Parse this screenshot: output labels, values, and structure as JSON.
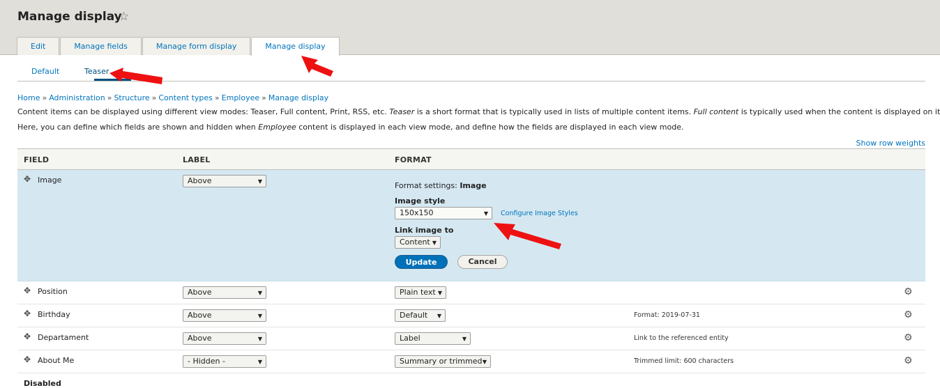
{
  "header": {
    "title": "Manage display",
    "star_glyph": "☆",
    "tabs": [
      {
        "label": "Edit"
      },
      {
        "label": "Manage fields"
      },
      {
        "label": "Manage form display"
      },
      {
        "label": "Manage display",
        "active": true
      }
    ]
  },
  "subtabs": [
    {
      "label": "Default"
    },
    {
      "label": "Teaser",
      "active": true
    }
  ],
  "breadcrumb": [
    "Home",
    "Administration",
    "Structure",
    "Content types",
    "Employee",
    "Manage display"
  ],
  "breadcrumb_sep": "»",
  "description": {
    "line1_a": "Content items can be displayed using different view modes: Teaser, Full content, Print, RSS, etc. ",
    "line1_em1": "Teaser",
    "line1_b": " is a short format that is typically used in lists of multiple content items. ",
    "line1_em2": "Full content",
    "line1_c": " is typically used when the content is displayed on its own page.",
    "line2_a": "Here, you can define which fields are shown and hidden when ",
    "line2_em": "Employee",
    "line2_b": " content is displayed in each view mode, and define how the fields are displayed in each view mode."
  },
  "show_row_weights": "Show row weights",
  "table": {
    "headers": {
      "field": "FIELD",
      "label": "LABEL",
      "format": "FORMAT"
    },
    "active_row": {
      "field": "Image",
      "label": "Above",
      "format_settings_prefix": "Format settings: ",
      "format_settings_name": "Image",
      "image_style_label": "Image style",
      "image_style_value": "150x150",
      "configure_link": "Configure Image Styles",
      "link_image_to_label": "Link image to",
      "link_image_to_value": "Content",
      "update_button": "Update",
      "cancel_button": "Cancel"
    },
    "rows": [
      {
        "field": "Position",
        "label": "Above",
        "format": "Plain text",
        "summary": ""
      },
      {
        "field": "Birthday",
        "label": "Above",
        "format": "Default",
        "summary": "Format: 2019-07-31"
      },
      {
        "field": "Departament",
        "label": "Above",
        "format": "Label",
        "summary": "Link to the referenced entity"
      },
      {
        "field": "About Me",
        "label": "- Hidden -",
        "format": "Summary or trimmed",
        "summary": "Trimmed limit: 600 characters"
      }
    ]
  },
  "disabled_label": "Disabled",
  "icons": {
    "drag_handle": "drag-handle-icon",
    "gear": "gear-icon",
    "dropdown": "dropdown-arrow-icon",
    "star": "star-icon"
  },
  "colors": {
    "annotation_arrow": "#ee1111",
    "link": "#0074bd",
    "update_button": "#0071b8",
    "active_row_bg": "#d5e8f2"
  }
}
